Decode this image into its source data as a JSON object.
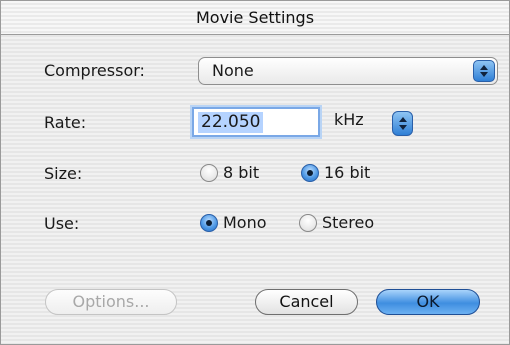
{
  "window": {
    "title": "Movie Settings"
  },
  "compressor": {
    "label": "Compressor:",
    "value": "None",
    "arrow_icon": "popup-arrows-icon"
  },
  "rate": {
    "label": "Rate:",
    "value": "22.050",
    "unit": "kHz",
    "stepper_icon": "stepper-arrows-icon"
  },
  "size": {
    "label": "Size:",
    "options": [
      {
        "label": "8 bit",
        "selected": false
      },
      {
        "label": "16 bit",
        "selected": true
      }
    ]
  },
  "use": {
    "label": "Use:",
    "options": [
      {
        "label": "Mono",
        "selected": true
      },
      {
        "label": "Stereo",
        "selected": false
      }
    ]
  },
  "buttons": {
    "options": "Options...",
    "cancel": "Cancel",
    "ok": "OK"
  },
  "colors": {
    "accent": "#3f8ee0",
    "selection": "#b5d3ff"
  }
}
